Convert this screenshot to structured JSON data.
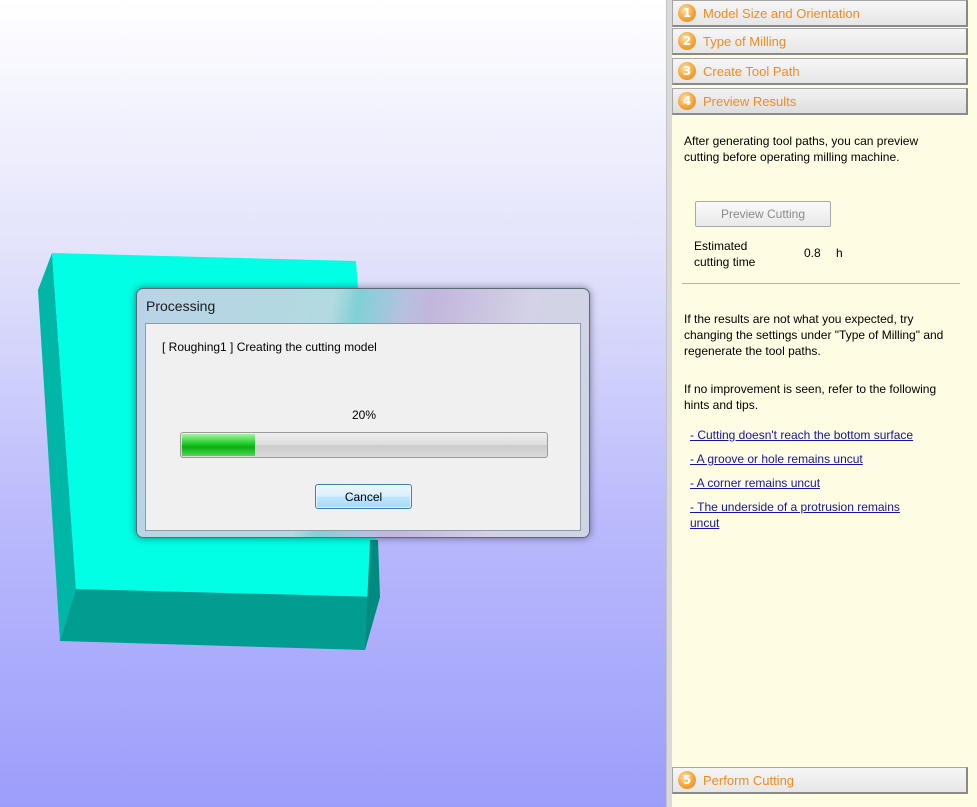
{
  "panel": {
    "steps": [
      {
        "num": "1",
        "label": "Model Size and Orientation"
      },
      {
        "num": "2",
        "label": "Type of Milling"
      },
      {
        "num": "3",
        "label": "Create Tool Path"
      },
      {
        "num": "4",
        "label": "Preview Results"
      },
      {
        "num": "5",
        "label": "Perform Cutting"
      }
    ],
    "intro": "After generating tool paths, you can preview cutting before operating milling machine.",
    "preview_button": "Preview Cutting",
    "estimate_label": "Estimated cutting time",
    "estimate_value": "0.8",
    "estimate_unit": "h",
    "hint1": "If the results are not what you expected, try changing the settings under \"Type of Milling\" and regenerate the tool paths.",
    "hint2": "If no improvement is seen, refer to the following hints and tips.",
    "links": [
      "- Cutting doesn't reach the bottom surface",
      "- A groove or hole remains uncut",
      "- A corner remains uncut",
      "- The underside of a protrusion remains uncut"
    ]
  },
  "dialog": {
    "title": "Processing",
    "message": "[ Roughing1 ]  Creating the cutting model",
    "percent_text": "20%",
    "progress": 0.2,
    "cancel_label": "Cancel"
  },
  "colors": {
    "model_top": "#00ffe4",
    "model_side": "#009d90",
    "step_text": "#f08a24",
    "link": "#1515a0"
  }
}
